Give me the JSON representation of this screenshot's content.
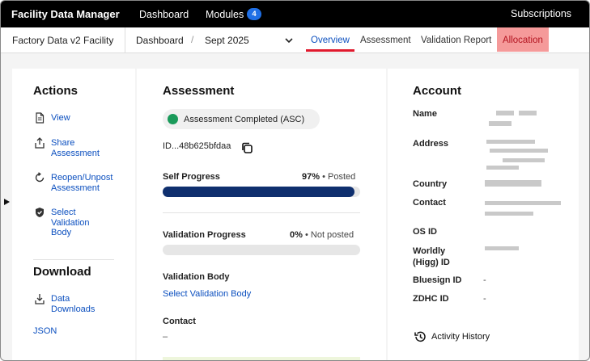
{
  "topbar": {
    "brand": "Facility Data Manager",
    "nav_dashboard": "Dashboard",
    "nav_modules": "Modules",
    "modules_count": "4",
    "nav_subscriptions": "Subscriptions"
  },
  "subbar": {
    "facility_name": "Factory Data v2 Facility",
    "crumb": "Dashboard",
    "separator": "/",
    "period": "Sept 2025",
    "tabs": [
      "Overview",
      "Assessment",
      "Validation Report",
      "Allocation"
    ],
    "active_tab": "Overview",
    "highlight_tab": "Allocation"
  },
  "actions": {
    "title": "Actions",
    "items": [
      {
        "icon": "document-icon",
        "label": "View"
      },
      {
        "icon": "share-icon",
        "label": "Share Assessment"
      },
      {
        "icon": "reopen-icon",
        "label": "Reopen/Unpost Assessment"
      },
      {
        "icon": "shield-icon",
        "label": "Select Validation Body"
      }
    ],
    "download_title": "Download",
    "downloads": [
      {
        "icon": "download-icon",
        "label": "Data Downloads"
      },
      {
        "label": "JSON"
      }
    ]
  },
  "assessment": {
    "title": "Assessment",
    "status": "Assessment Completed (ASC)",
    "status_color": "#1a9a5a",
    "id_text": "ID...48b625bfdaa",
    "self_progress_label": "Self Progress",
    "self_progress_pct": "97%",
    "self_progress_state": "• Posted",
    "self_progress_value": 0.97,
    "validation_progress_label": "Validation Progress",
    "validation_progress_pct": "0%",
    "validation_progress_state": "• Not posted",
    "validation_progress_value": 0,
    "validation_body_label": "Validation Body",
    "validation_body_link": "Select Validation Body",
    "contact_label": "Contact",
    "contact_value": "–"
  },
  "account": {
    "title": "Account",
    "fields": {
      "name": "Name",
      "address": "Address",
      "country": "Country",
      "contact": "Contact",
      "os_id": "OS ID",
      "worldly_id": "Worldly (Higg) ID",
      "bluesign_id": "Bluesign ID",
      "bluesign_value": "-",
      "zdhc_id": "ZDHC ID",
      "zdhc_value": "-"
    },
    "activity_history": "Activity History"
  },
  "colors": {
    "topbar": "#000000",
    "link": "#0b4fbf",
    "active_underline": "#e0192d",
    "allocation_bg": "#f59a9a",
    "progress_fill": "#0f2f6e",
    "badge": "#1f6fe5"
  }
}
